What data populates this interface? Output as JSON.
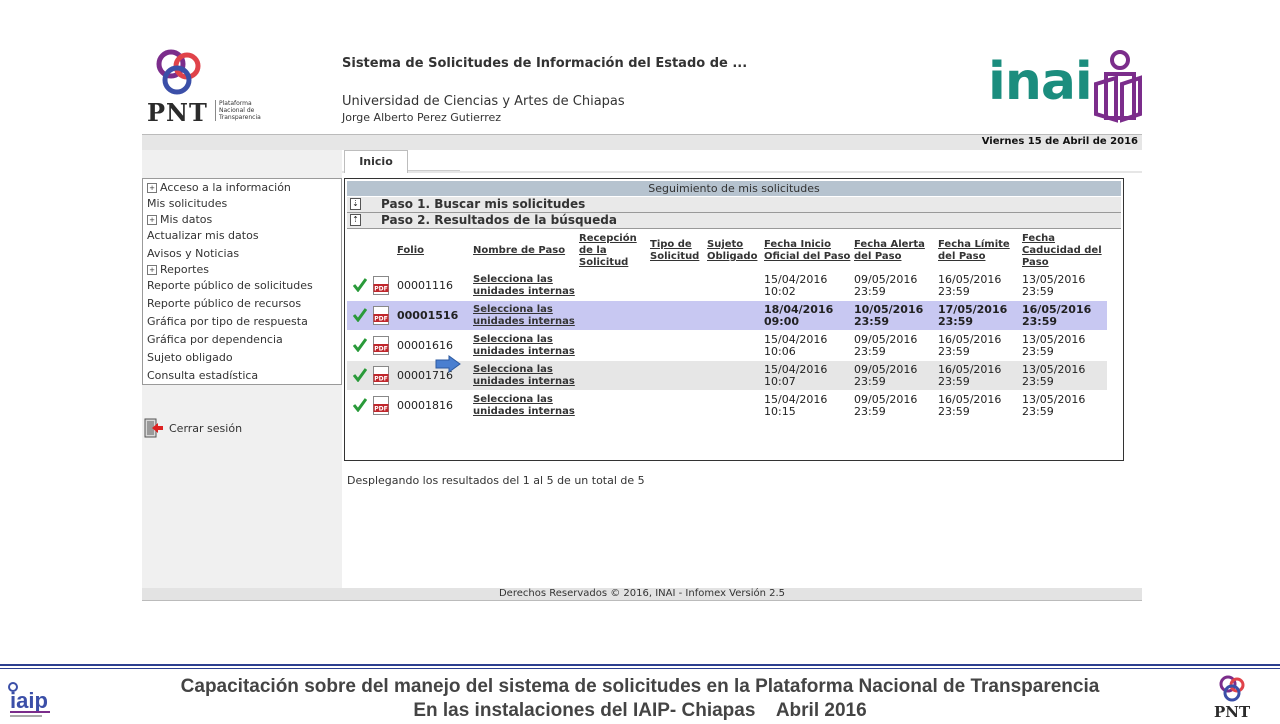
{
  "header": {
    "pnt_wordmark": "PNT",
    "pnt_subtitle": "Plataforma Nacional de Transparencia",
    "system_title": "Sistema de Solicitudes de Información del Estado de ...",
    "institution": "Universidad de Ciencias y Artes de Chiapas",
    "user": "Jorge Alberto Perez Gutierrez",
    "inai_wordmark": "inai",
    "date": "Viernes 15 de Abril de 2016"
  },
  "tabs": [
    {
      "label": "Inicio"
    }
  ],
  "sidebar": {
    "items": [
      {
        "label": "Acceso a la información",
        "expandable": true
      },
      {
        "label": "Mis solicitudes",
        "expandable": false
      },
      {
        "label": "Mis datos",
        "expandable": true
      },
      {
        "label": "Actualizar mis datos",
        "expandable": false
      },
      {
        "label": "Avisos y Noticias",
        "expandable": false
      },
      {
        "label": "Reportes",
        "expandable": true
      },
      {
        "label": "Reporte público de solicitudes",
        "expandable": false
      },
      {
        "label": "Reporte público de recursos",
        "expandable": false
      },
      {
        "label": "Gráfica por tipo de respuesta",
        "expandable": false
      },
      {
        "label": "Gráfica por dependencia",
        "expandable": false
      },
      {
        "label": "Sujeto obligado",
        "expandable": false
      },
      {
        "label": "Consulta estadística",
        "expandable": false
      }
    ],
    "logout_label": "Cerrar sesión"
  },
  "panel": {
    "title": "Seguimiento de mis solicitudes",
    "step1": "Paso 1. Buscar mis solicitudes",
    "step2": "Paso 2. Resultados de la búsqueda"
  },
  "table": {
    "columns": {
      "folio": "Folio",
      "nombre_paso": "Nombre de Paso",
      "recepcion": [
        "Recepción",
        "de la",
        "Solicitud"
      ],
      "tipo": [
        "Tipo de",
        "Solicitud"
      ],
      "sujeto": [
        "Sujeto",
        "Obligado"
      ],
      "inicio": [
        "Fecha Inicio",
        "Oficial del Paso"
      ],
      "alerta": [
        "Fecha Alerta",
        "del Paso"
      ],
      "limite": [
        "Fecha Límite",
        "del Paso"
      ],
      "caducidad": [
        "Fecha",
        "Caducidad del",
        "Paso"
      ]
    },
    "rows": [
      {
        "folio": "00001116",
        "paso": [
          "Selecciona las",
          "unidades internas"
        ],
        "inicio": [
          "15/04/2016",
          "10:02"
        ],
        "alerta": [
          "09/05/2016",
          "23:59"
        ],
        "limite": [
          "16/05/2016",
          "23:59"
        ],
        "caducidad": [
          "13/05/2016",
          "23:59"
        ],
        "selected": false
      },
      {
        "folio": "00001516",
        "paso": [
          "Selecciona las",
          "unidades internas"
        ],
        "inicio": [
          "18/04/2016",
          "09:00"
        ],
        "alerta": [
          "10/05/2016",
          "23:59"
        ],
        "limite": [
          "17/05/2016",
          "23:59"
        ],
        "caducidad": [
          "16/05/2016",
          "23:59"
        ],
        "selected": true
      },
      {
        "folio": "00001616",
        "paso": [
          "Selecciona las",
          "unidades internas"
        ],
        "inicio": [
          "15/04/2016",
          "10:06"
        ],
        "alerta": [
          "09/05/2016",
          "23:59"
        ],
        "limite": [
          "16/05/2016",
          "23:59"
        ],
        "caducidad": [
          "13/05/2016",
          "23:59"
        ],
        "selected": false
      },
      {
        "folio": "00001716",
        "paso": [
          "Selecciona las",
          "unidades internas"
        ],
        "inicio": [
          "15/04/2016",
          "10:07"
        ],
        "alerta": [
          "09/05/2016",
          "23:59"
        ],
        "limite": [
          "16/05/2016",
          "23:59"
        ],
        "caducidad": [
          "13/05/2016",
          "23:59"
        ],
        "selected": false
      },
      {
        "folio": "00001816",
        "paso": [
          "Selecciona las",
          "unidades internas"
        ],
        "inicio": [
          "15/04/2016",
          "10:15"
        ],
        "alerta": [
          "09/05/2016",
          "23:59"
        ],
        "limite": [
          "16/05/2016",
          "23:59"
        ],
        "caducidad": [
          "13/05/2016",
          "23:59"
        ],
        "selected": false
      }
    ],
    "summary": "Desplegando los resultados del 1 al 5 de un total de 5"
  },
  "footer": {
    "copyright": "Derechos Reservados © 2016, INAI - Infomex Versión 2.5"
  },
  "slide": {
    "caption_line1": "Capacitación sobre del manejo del sistema de solicitudes en la Plataforma Nacional de Transparencia",
    "caption_line2": "En las instalaciones del IAIP- Chiapas    Abril 2016",
    "iaip_wordmark": "iaip",
    "pnt_small_wordmark": "PNT"
  },
  "colors": {
    "panel_header": "#b6c3cf",
    "selected_row": "#c8c8f2",
    "inai_teal": "#1b8d7e",
    "inai_purple": "#7b2d8b",
    "pdf_red": "#c0262c",
    "check_green": "#2a9a3a",
    "slide_rule": "#2d3f8f"
  }
}
